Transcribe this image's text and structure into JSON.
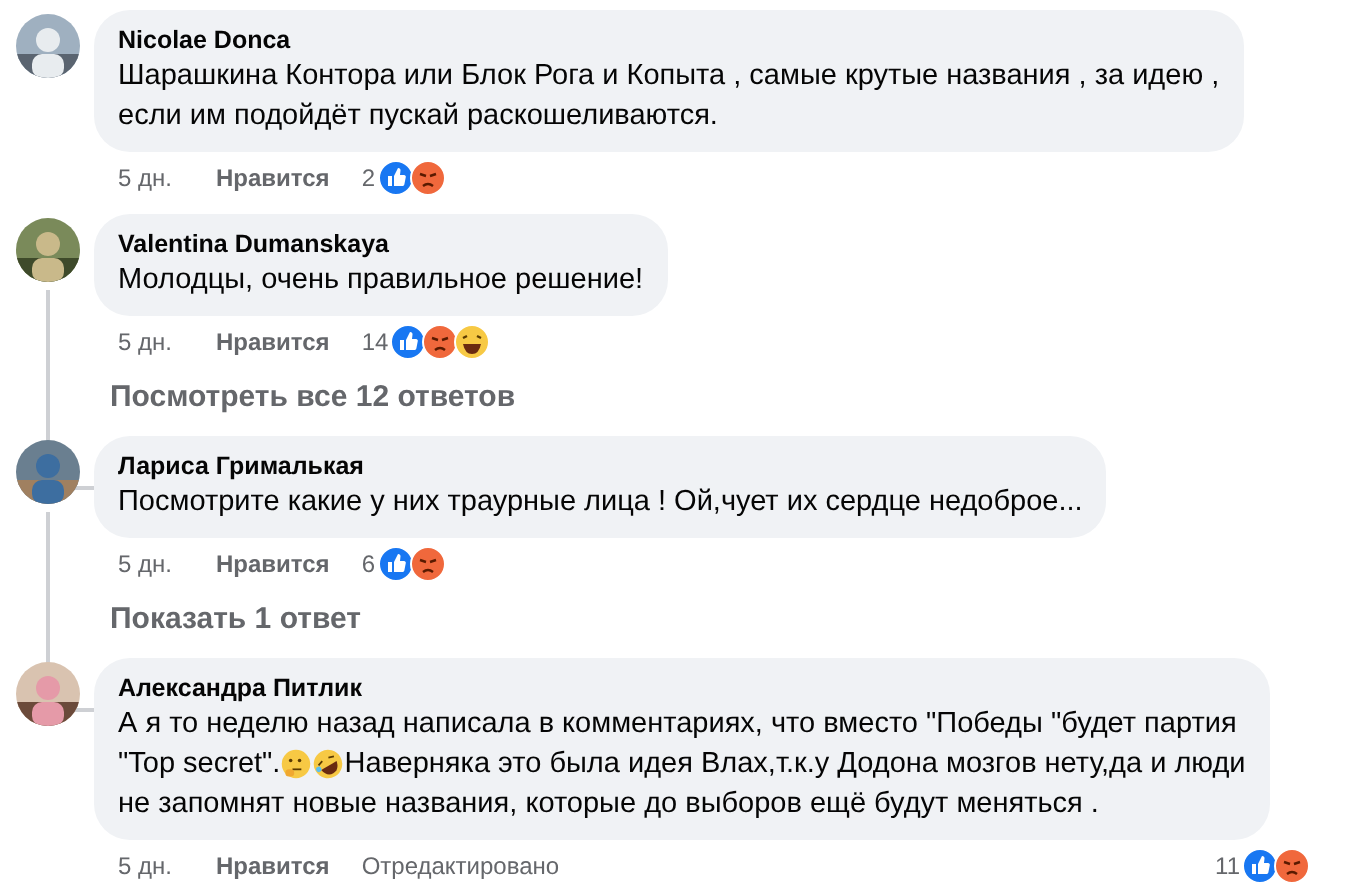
{
  "comments": [
    {
      "author": "Nicolae Donca",
      "lines": [
        [
          {
            "kind": "text",
            "text": "Шарашкина Контора или Блок Рога и Копыта , самые крутые названия , за идею ,"
          }
        ],
        [
          {
            "kind": "text",
            "text": "если им подойдёт пускай раскошеливаются."
          }
        ]
      ],
      "time": "5 дн.",
      "like_label": "Нравится",
      "reaction_count": "2",
      "reactions": [
        {
          "kind": "like"
        },
        {
          "kind": "angry"
        }
      ]
    },
    {
      "author": "Valentina Dumanskaya",
      "lines": [
        [
          {
            "kind": "text",
            "text": "Молодцы, очень правильное решение!"
          }
        ]
      ],
      "time": "5 дн.",
      "like_label": "Нравится",
      "reaction_count": "14",
      "reactions": [
        {
          "kind": "like"
        },
        {
          "kind": "angry"
        },
        {
          "kind": "haha"
        }
      ],
      "replies_link": "Посмотреть все 12 ответов"
    },
    {
      "author": "Лариса Грималькая",
      "lines": [
        [
          {
            "kind": "text",
            "text": "Посмотрите какие у них траурные лица ! Ой,чует их сердце недоброе..."
          }
        ]
      ],
      "time": "5 дн.",
      "like_label": "Нравится",
      "reaction_count": "6",
      "reactions": [
        {
          "kind": "like"
        },
        {
          "kind": "angry"
        }
      ],
      "replies_link": "Показать 1 ответ"
    },
    {
      "author": "Александра Питлик",
      "lines": [
        [
          {
            "kind": "text",
            "text": "А я то неделю назад написала в комментариях, что вместо \"Победы \"будет партия"
          }
        ],
        [
          {
            "kind": "text",
            "text": "\"Top secret\"."
          },
          {
            "kind": "thinking"
          },
          {
            "kind": "rofl"
          },
          {
            "kind": "text",
            "text": "Наверняка это была идея Влах,т.к.у Додона мозгов нету,да и люди"
          }
        ],
        [
          {
            "kind": "text",
            "text": "не запомнят новые названия, которые до выборов ещё будут меняться ."
          }
        ]
      ],
      "time": "5 дн.",
      "like_label": "Нравится",
      "edited": "Отредактировано",
      "reaction_count": "11",
      "reactions": [
        {
          "kind": "like"
        },
        {
          "kind": "angry"
        }
      ]
    }
  ]
}
